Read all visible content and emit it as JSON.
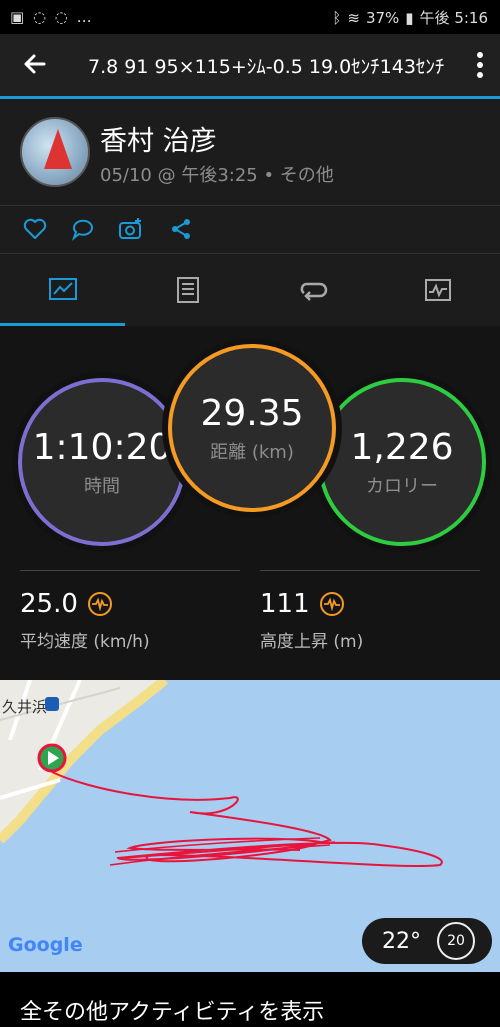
{
  "status": {
    "left_icons": "▣ ◌ ◌ …",
    "battery": "37%",
    "time": "午後 5:16"
  },
  "appbar": {
    "title": "7.8 91 95×115+ｼﾑ-0.5 19.0ｾﾝﾁ143ｾﾝﾁ"
  },
  "header": {
    "name": "香村 治彦",
    "meta": "05/10 @ 午後3:25 • その他"
  },
  "stats": {
    "time_value": "1:10:20",
    "time_label": "時間",
    "distance_value": "29.35",
    "distance_label": "距離 (km)",
    "calories_value": "1,226",
    "calories_label": "カロリー",
    "avg_speed_value": "25.0",
    "avg_speed_label": "平均速度 (km/h)",
    "elevation_value": "111",
    "elevation_label": "高度上昇 (m)"
  },
  "colors": {
    "time_ring": "#7d6fd1",
    "distance_ring": "#f59a23",
    "calories_ring": "#2ecc40",
    "accent": "#1a9ad6",
    "route": "#e8143c"
  },
  "map": {
    "place_label": "久井浜",
    "temperature": "22°",
    "wind": "20",
    "google": "Google"
  },
  "footer": {
    "link": "全その他アクティビティを表示"
  }
}
